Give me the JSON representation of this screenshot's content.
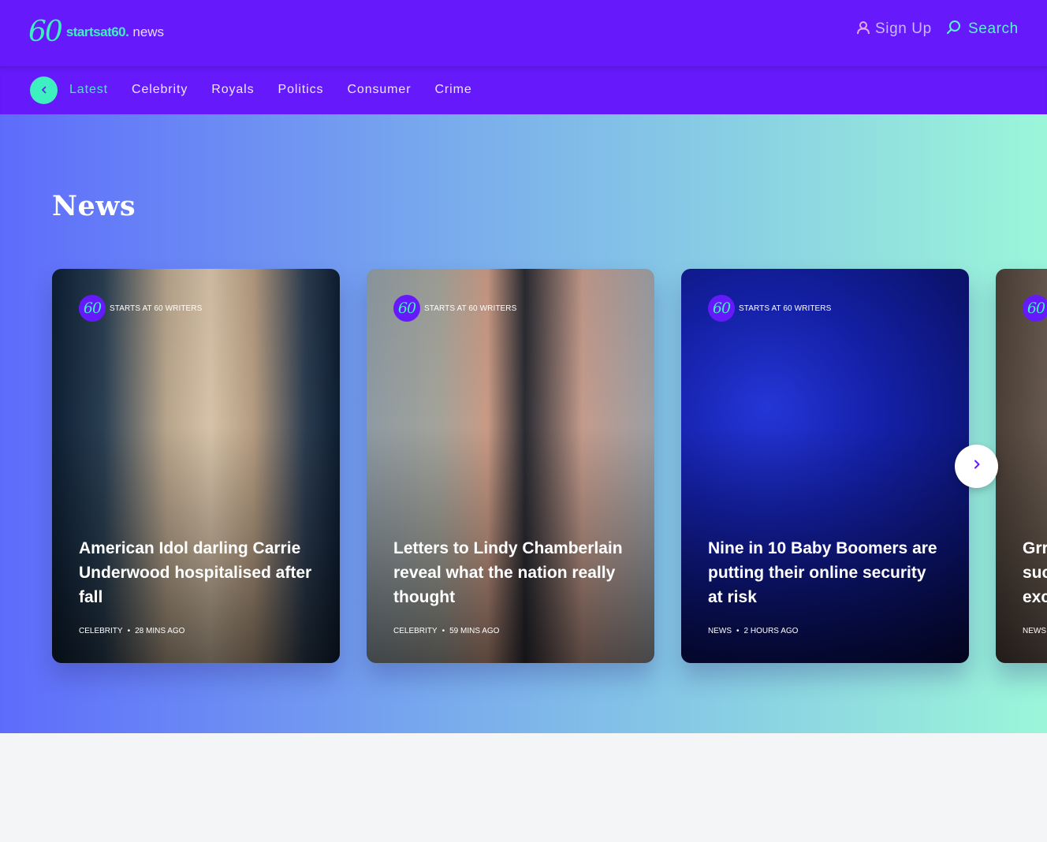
{
  "header": {
    "logo_60": "60",
    "logo_starts": "startsat60.",
    "logo_news": "news",
    "signup_label": "Sign Up",
    "search_label": "Search"
  },
  "nav": {
    "items": [
      {
        "label": "Latest",
        "active": true
      },
      {
        "label": "Celebrity"
      },
      {
        "label": "Royals"
      },
      {
        "label": "Politics"
      },
      {
        "label": "Consumer"
      },
      {
        "label": "Crime"
      }
    ]
  },
  "hero": {
    "title": "News"
  },
  "cards": [
    {
      "author": "STARTS AT 60 WRITERS",
      "title": "American Idol darling Carrie Underwood hospitalised after fall",
      "category": "CELEBRITY",
      "time": "28 MINS AGO"
    },
    {
      "author": "STARTS AT 60 WRITERS",
      "title": "Letters to Lindy Chamberlain reveal what the nation really thought",
      "category": "CELEBRITY",
      "time": "59 MINS AGO"
    },
    {
      "author": "STARTS AT 60 WRITERS",
      "title": "Nine in 10 Baby Boomers are putting their online security at risk",
      "category": "NEWS",
      "time": "2 HOURS AGO"
    },
    {
      "author": "",
      "title": "Grr suc exc",
      "category": "NEWS",
      "time": ""
    }
  ],
  "avatar_text": "60",
  "colors": {
    "brand_purple": "#6619fa",
    "brand_mint": "#3ef0c0",
    "page_bg": "#f4f5f7"
  }
}
